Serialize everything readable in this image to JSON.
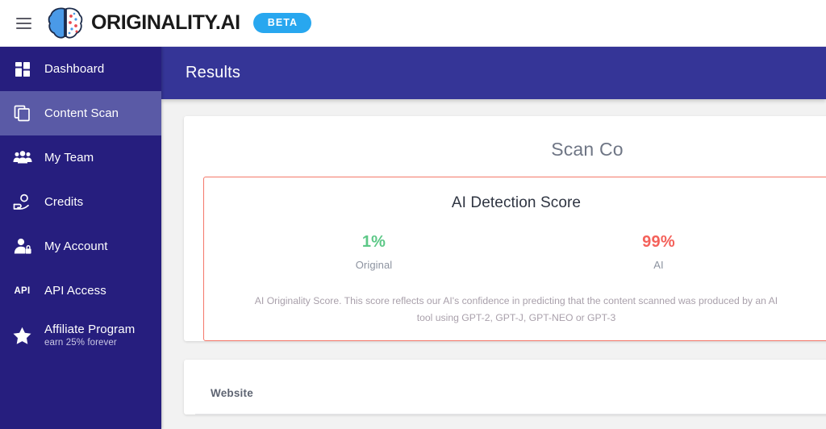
{
  "topbar": {
    "menu_icon": "hamburger-icon",
    "logo_icon": "brain-logo-icon",
    "wordmark": "ORIGINALITY.AI",
    "beta_label": "BETA"
  },
  "sidebar": {
    "items": [
      {
        "label": "Dashboard",
        "sub": "",
        "icon": "grid-dashboard-icon",
        "active": false
      },
      {
        "label": "Content Scan",
        "sub": "",
        "icon": "copy-documents-icon",
        "active": true
      },
      {
        "label": "My Team",
        "sub": "",
        "icon": "people-group-icon",
        "active": false
      },
      {
        "label": "Credits",
        "sub": "",
        "icon": "hand-coin-icon",
        "active": false
      },
      {
        "label": "My Account",
        "sub": "",
        "icon": "user-lock-icon",
        "active": false
      },
      {
        "label": "API Access",
        "sub": "",
        "icon": "api-text-icon",
        "active": false
      },
      {
        "label": "Affiliate Program",
        "sub": "earn 25% forever",
        "icon": "star-icon",
        "active": false
      }
    ]
  },
  "main": {
    "results_title": "Results",
    "panel_heading": "Scan Co",
    "score_card": {
      "title": "AI Detection Score",
      "original_pct": "1%",
      "original_label": "Original",
      "ai_pct": "99%",
      "ai_label": "AI",
      "description_line1": "AI Originality Score. This score reflects our AI's confidence in predicting that the content scanned was produced by an AI tool using",
      "description_line2": "GPT-2, GPT-J, GPT-NEO or GPT-3"
    },
    "website_panel": {
      "label": "Website"
    }
  },
  "colors": {
    "sidebar_bg": "#261e7e",
    "sidebar_active": "#5a5aa6",
    "results_bar": "#353597",
    "beta_badge": "#28a7ef",
    "score_border": "#f4786a",
    "original_green": "#5dc887",
    "ai_red": "#f4615a",
    "page_bg": "#f2f2f2"
  }
}
